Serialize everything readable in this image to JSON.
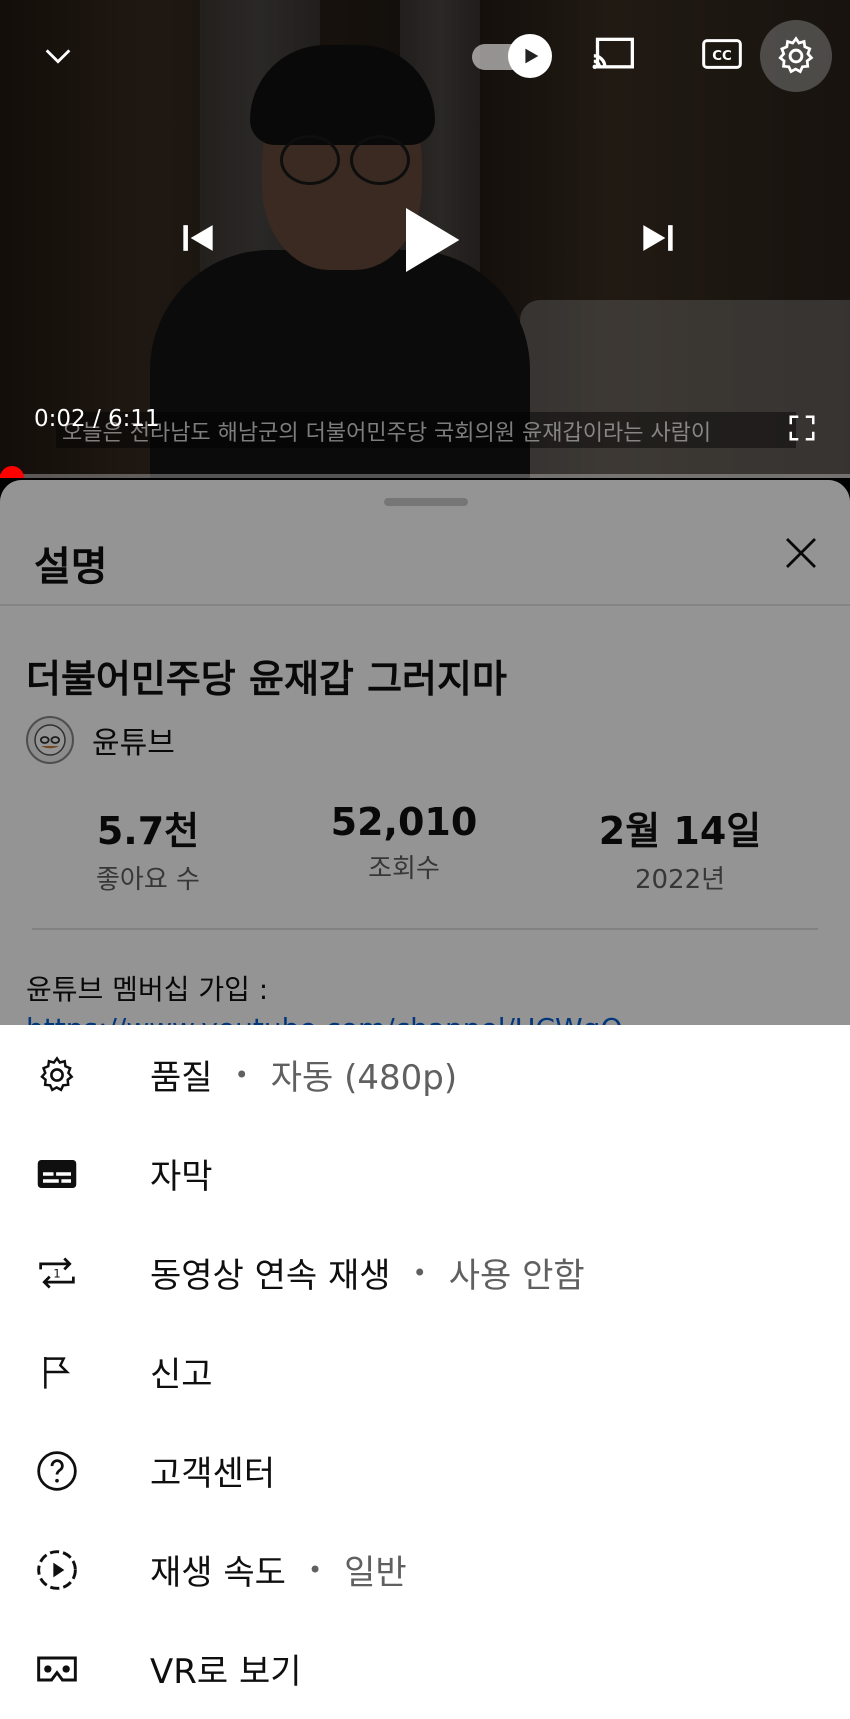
{
  "player": {
    "time": "0:02 / 6:11",
    "subtitle": "오늘은 전라남도 해남군의 더불어민주당 국회의원 윤재갑이라는 사람이",
    "progress_fraction": 0.005,
    "accent_color": "#ff0000"
  },
  "description": {
    "header": "설명",
    "video_title": "더불어민주당 윤재갑 그러지마",
    "channel_name": "윤튜브",
    "stats": [
      {
        "value": "5.7천",
        "label": "좋아요 수"
      },
      {
        "value": "52,010",
        "label": "조회수"
      },
      {
        "value": "2월 14일",
        "label": "2022년"
      }
    ],
    "membership_text": "윤튜브 멤버십 가입 :",
    "link_text": "https://www.youtube.com/channel/UCWgQ"
  },
  "menu": {
    "items": [
      {
        "icon": "gear-icon",
        "label": "품질",
        "value": "자동 (480p)"
      },
      {
        "icon": "subtitles-icon",
        "label": "자막",
        "value": ""
      },
      {
        "icon": "repeat-one-icon",
        "label": "동영상 연속 재생",
        "value": "사용 안함"
      },
      {
        "icon": "flag-icon",
        "label": "신고",
        "value": ""
      },
      {
        "icon": "help-icon",
        "label": "고객센터",
        "value": ""
      },
      {
        "icon": "playback-speed-icon",
        "label": "재생 속도",
        "value": "일반"
      },
      {
        "icon": "vr-icon",
        "label": "VR로 보기",
        "value": ""
      }
    ]
  }
}
